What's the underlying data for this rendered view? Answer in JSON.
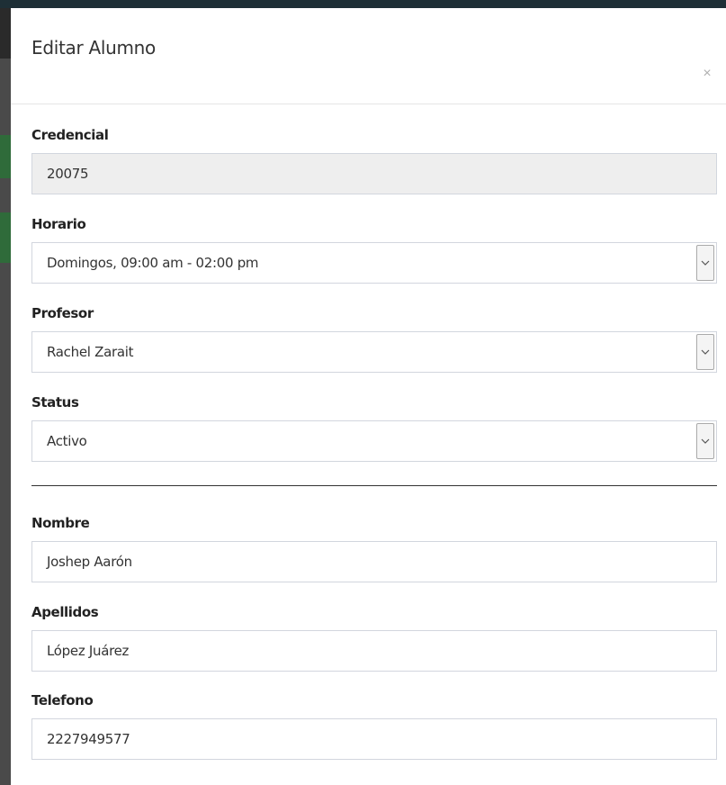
{
  "modal": {
    "title": "Editar Alumno",
    "close_label": "×"
  },
  "form": {
    "credencial": {
      "label": "Credencial",
      "value": "20075"
    },
    "horario": {
      "label": "Horario",
      "value": "Domingos, 09:00 am - 02:00 pm"
    },
    "profesor": {
      "label": "Profesor",
      "value": "Rachel Zarait"
    },
    "status": {
      "label": "Status",
      "value": "Activo"
    },
    "nombre": {
      "label": "Nombre",
      "value": "Joshep Aarón"
    },
    "apellidos": {
      "label": "Apellidos",
      "value": "López Juárez"
    },
    "telefono": {
      "label": "Telefono",
      "value": "2227949577"
    }
  },
  "icons": {
    "close": "close-icon",
    "select_arrow": "chevron-down-icon"
  },
  "colors": {
    "background_overlay": "#3f3f3f",
    "accent_green": "#2f6b3a",
    "readonly_bg": "#eeeeee",
    "border": "#d2d6de"
  }
}
